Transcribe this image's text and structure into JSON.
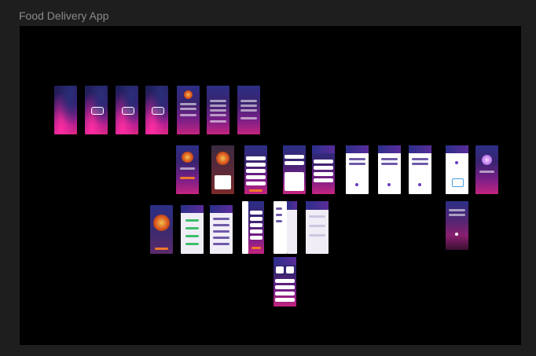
{
  "frame": {
    "title": "Food Delivery App"
  },
  "colors": {
    "canvas": "#000000",
    "chrome": "#1e1e1e",
    "brand_blue": "#2c2f86",
    "brand_pink": "#e0287f",
    "accent_orange": "#f0782a"
  }
}
